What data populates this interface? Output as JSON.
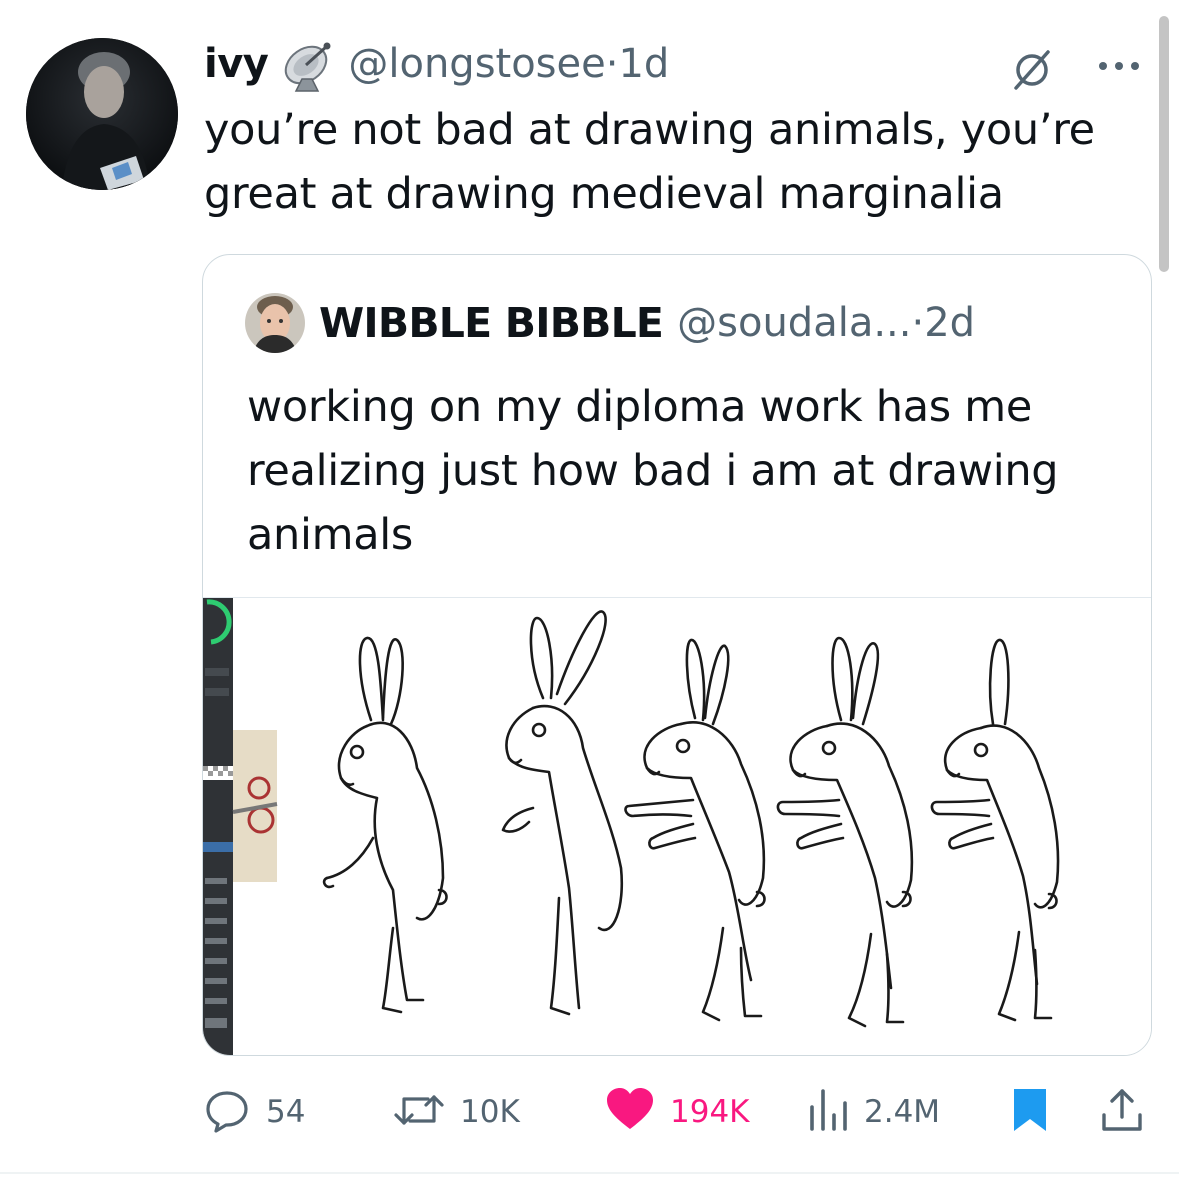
{
  "tweet": {
    "author_name": "ivy",
    "author_handle": "@longstosee",
    "time_sep": " · ",
    "time": "1d",
    "text": "you’re not bad at drawing animals, you’re great at drawing medieval marginalia"
  },
  "quoted": {
    "author_name": "WIBBLE BIBBLE",
    "author_handle": "@soudala...",
    "time_sep": " · ",
    "time": "2d",
    "text": "working on my diploma work has me realizing just how bad i am at drawing animals"
  },
  "actions": {
    "replies": "54",
    "reposts": "10K",
    "likes": "194K",
    "views": "2.4M"
  },
  "colors": {
    "text": "#0f1419",
    "muted": "#536471",
    "like": "#f91880",
    "bookmark": "#1d9bf0",
    "border": "#cfd9de"
  },
  "icons": [
    "satellite-dish-badge-icon",
    "grok-icon",
    "more-icon",
    "reply-icon",
    "repost-icon",
    "heart-icon",
    "views-icon",
    "bookmark-icon",
    "share-icon"
  ]
}
